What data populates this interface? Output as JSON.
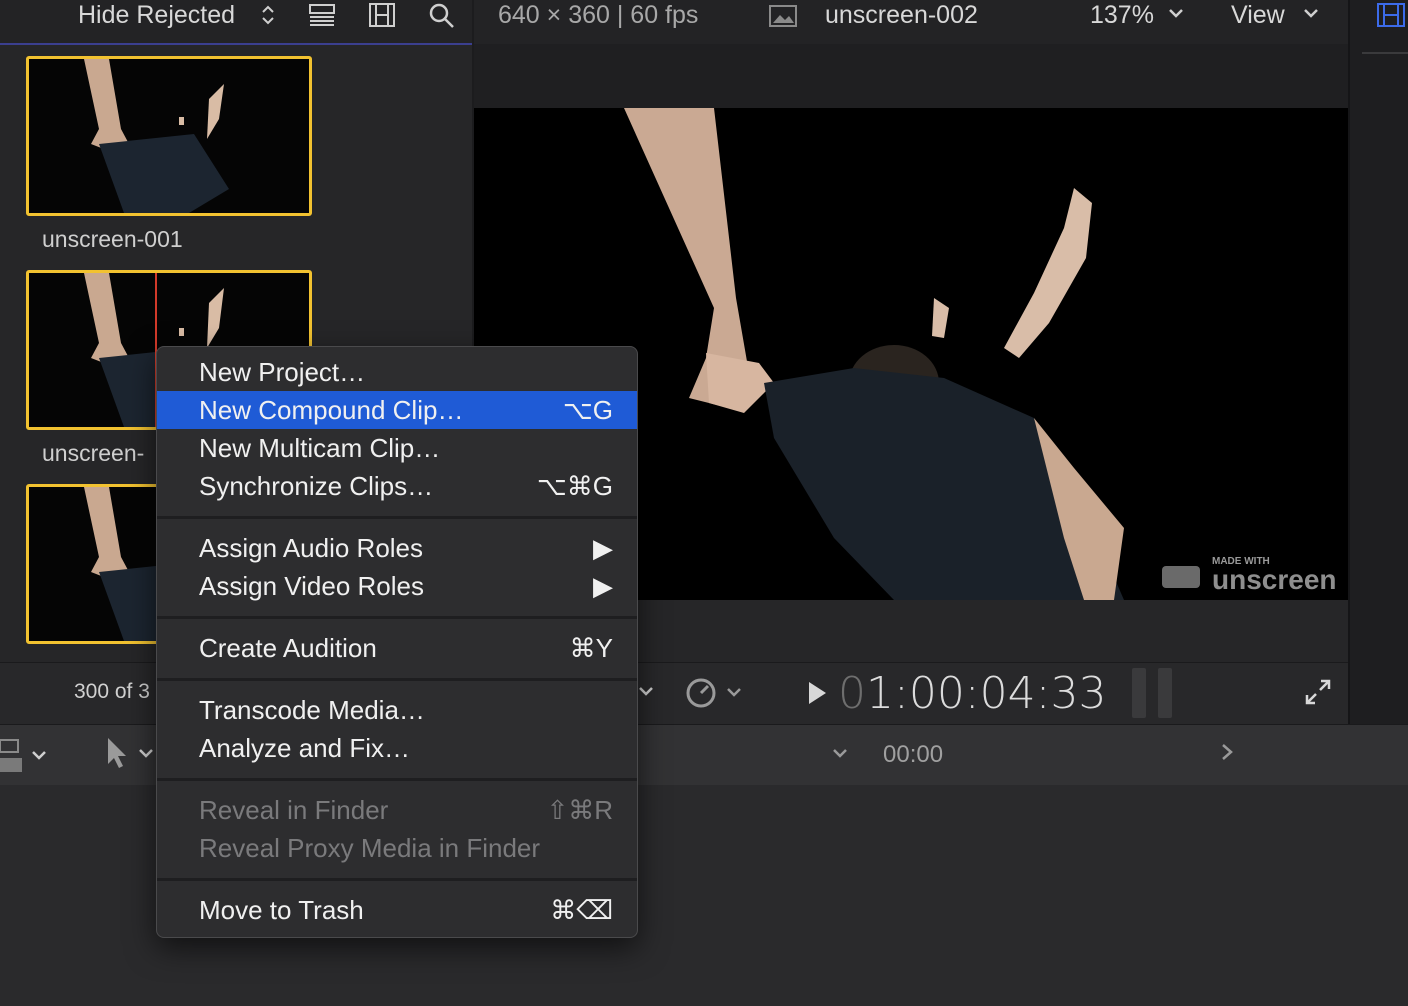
{
  "browser": {
    "filter_label": "Hide Rejected",
    "clip_count": "300 of 3",
    "clips": [
      {
        "label": "unscreen-001"
      },
      {
        "label": "unscreen-"
      },
      {
        "label": ""
      }
    ]
  },
  "viewer": {
    "format": "640 × 360 | 60 fps",
    "clip_name": "unscreen-002",
    "zoom": "137%",
    "view_label": "View",
    "timecode_prefix": "0",
    "timecode": "1:00:04:33",
    "watermark_small": "MADE WITH",
    "watermark_big": "unscreen"
  },
  "timeline": {
    "time": "00:00"
  },
  "context_menu": {
    "items": [
      {
        "label": "New Project…",
        "shortcut": ""
      },
      {
        "label": "New Compound Clip…",
        "shortcut": "⌥G"
      },
      {
        "label": "New Multicam Clip…",
        "shortcut": ""
      },
      {
        "label": "Synchronize Clips…",
        "shortcut": "⌥⌘G"
      },
      {
        "label": "Assign Audio Roles",
        "shortcut": "▶"
      },
      {
        "label": "Assign Video Roles",
        "shortcut": "▶"
      },
      {
        "label": "Create Audition",
        "shortcut": "⌘Y"
      },
      {
        "label": "Transcode Media…",
        "shortcut": ""
      },
      {
        "label": "Analyze and Fix…",
        "shortcut": ""
      },
      {
        "label": "Reveal in Finder",
        "shortcut": "⇧⌘R"
      },
      {
        "label": "Reveal Proxy Media in Finder",
        "shortcut": ""
      },
      {
        "label": "Move to Trash",
        "shortcut": "⌘⌫"
      }
    ]
  },
  "colors": {
    "accent": "#1f5bd6",
    "selection_border": "#f2c230",
    "playhead": "#d23a2a"
  },
  "icons": [
    "chevron-updown-icon",
    "list-view-icon",
    "filmstrip-icon",
    "search-icon",
    "image-icon",
    "chevron-down-icon",
    "speed-icon",
    "play-icon",
    "fullscreen-icon",
    "arrow-tool-icon",
    "chevron-right-icon",
    "trash-delete-icon"
  ]
}
